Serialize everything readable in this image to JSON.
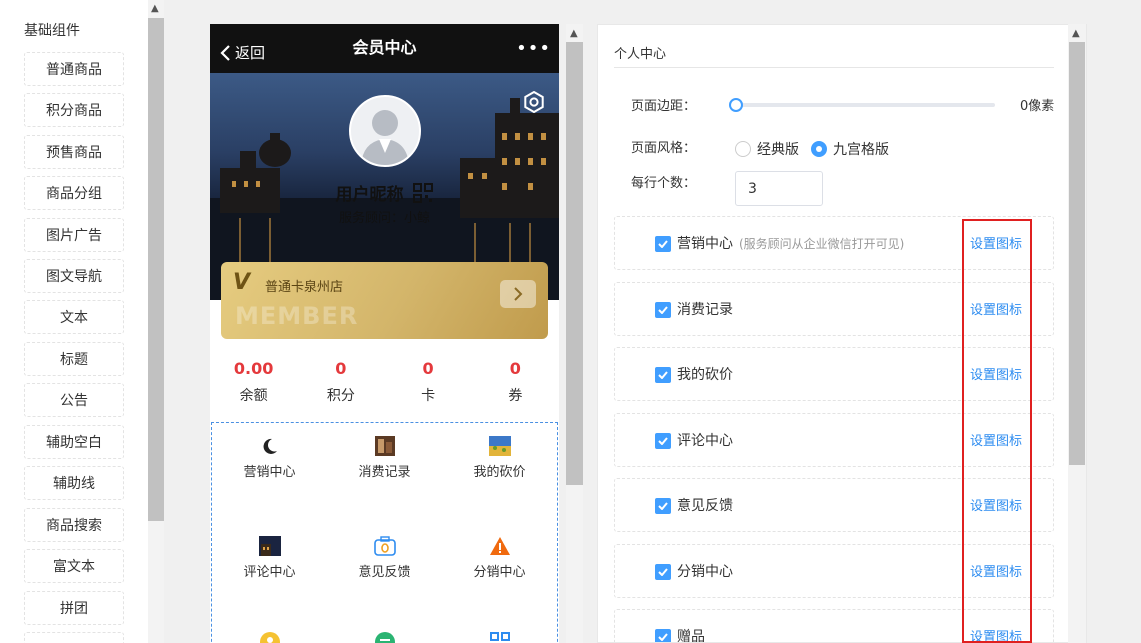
{
  "sidebar": {
    "title": "基础组件",
    "items": [
      "普通商品",
      "积分商品",
      "预售商品",
      "商品分组",
      "图片广告",
      "图文导航",
      "文本",
      "标题",
      "公告",
      "辅助空白",
      "辅助线",
      "商品搜索",
      "富文本",
      "拼团"
    ]
  },
  "phone": {
    "nav": {
      "back": "返回",
      "title": "会员中心",
      "more": "•••"
    },
    "profile": {
      "username": "用户昵称",
      "advisor": "服务顾问：小鲸"
    },
    "card": {
      "logo": "V",
      "name": "普通卡泉州店",
      "watermark": "MEMBER"
    },
    "stats": [
      {
        "value": "0.00",
        "label": "余额"
      },
      {
        "value": "0",
        "label": "积分"
      },
      {
        "value": "0",
        "label": "卡"
      },
      {
        "value": "0",
        "label": "券"
      }
    ],
    "grid": [
      {
        "label": "营销中心",
        "icon": "moon-icon"
      },
      {
        "label": "消费记录",
        "icon": "photo-icon"
      },
      {
        "label": "我的砍价",
        "icon": "photo-icon"
      },
      {
        "label": "评论中心",
        "icon": "photo-icon"
      },
      {
        "label": "意见反馈",
        "icon": "camera-icon"
      },
      {
        "label": "分销中心",
        "icon": "warning-icon"
      }
    ]
  },
  "panel": {
    "title": "个人中心",
    "margin_label": "页面边距：",
    "margin_value": "0像素",
    "margin_fraction": 0,
    "style_label": "页面风格：",
    "style_options": [
      "经典版",
      "九宫格版"
    ],
    "style_selected": "九宫格版",
    "per_row_label": "每行个数：",
    "per_row_value": "3",
    "set_icon_label": "设置图标",
    "items": [
      {
        "name": "营销中心",
        "note": "(服务顾问从企业微信打开可见)",
        "checked": true
      },
      {
        "name": "消费记录",
        "note": "",
        "checked": true
      },
      {
        "name": "我的砍价",
        "note": "",
        "checked": true
      },
      {
        "name": "评论中心",
        "note": "",
        "checked": true
      },
      {
        "name": "意见反馈",
        "note": "",
        "checked": true
      },
      {
        "name": "分销中心",
        "note": "",
        "checked": true
      },
      {
        "name": "赠品",
        "note": "",
        "checked": true
      }
    ]
  },
  "colors": {
    "accent": "#409eff",
    "link": "#2d8cf0",
    "price": "#e4393c",
    "highlight": "#e02020"
  }
}
